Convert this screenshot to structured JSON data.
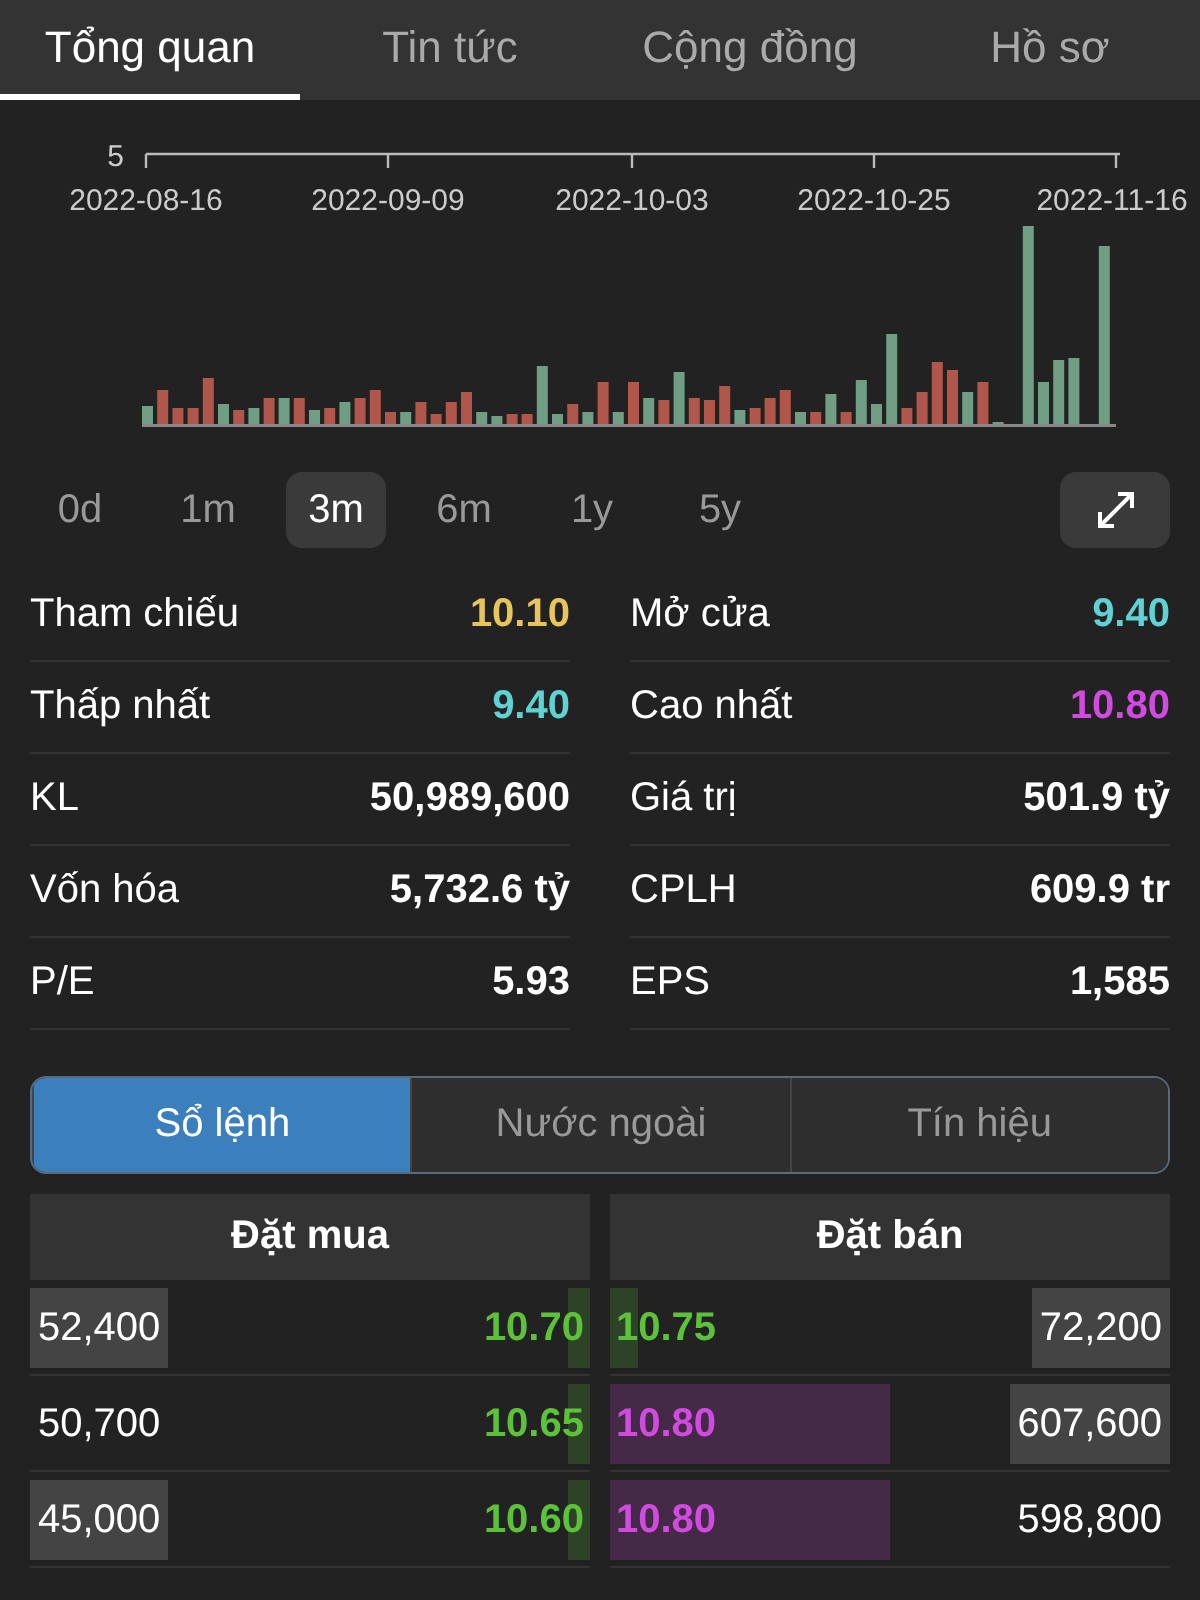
{
  "tabs": [
    {
      "label": "Tổng quan",
      "selected": true
    },
    {
      "label": "Tin tức",
      "selected": false
    },
    {
      "label": "Cộng đồng",
      "selected": false
    },
    {
      "label": "Hồ sơ",
      "selected": false
    }
  ],
  "price_axis": {
    "y_tick": "5",
    "dates": [
      "2022-08-16",
      "2022-09-09",
      "2022-10-03",
      "2022-10-25",
      "2022-11-16"
    ]
  },
  "periods": [
    {
      "label": "0d",
      "selected": false
    },
    {
      "label": "1m",
      "selected": false
    },
    {
      "label": "3m",
      "selected": true
    },
    {
      "label": "6m",
      "selected": false
    },
    {
      "label": "1y",
      "selected": false
    },
    {
      "label": "5y",
      "selected": false
    }
  ],
  "stats": [
    [
      {
        "label": "Tham chiếu",
        "value": "10.10",
        "color": "#e8c55a"
      },
      {
        "label": "Mở cửa",
        "value": "9.40",
        "color": "#5fd3d3"
      }
    ],
    [
      {
        "label": "Thấp nhất",
        "value": "9.40",
        "color": "#5fd3d3"
      },
      {
        "label": "Cao nhất",
        "value": "10.80",
        "color": "#d24be0"
      }
    ],
    [
      {
        "label": "KL",
        "value": "50,989,600",
        "color": "#ffffff"
      },
      {
        "label": "Giá trị",
        "value": "501.9 tỷ",
        "color": "#ffffff"
      }
    ],
    [
      {
        "label": "Vốn hóa",
        "value": "5,732.6 tỷ",
        "color": "#ffffff"
      },
      {
        "label": "CPLH",
        "value": "609.9 tr",
        "color": "#ffffff"
      }
    ],
    [
      {
        "label": "P/E",
        "value": "5.93",
        "color": "#ffffff"
      },
      {
        "label": "EPS",
        "value": "1,585",
        "color": "#ffffff"
      }
    ]
  ],
  "segments": [
    {
      "label": "Sổ lệnh",
      "selected": true
    },
    {
      "label": "Nước ngoài",
      "selected": false
    },
    {
      "label": "Tín hiệu",
      "selected": false
    }
  ],
  "order_book": {
    "buy_header": "Đặt mua",
    "sell_header": "Đặt bán",
    "rows": [
      {
        "buy": {
          "volume": "52,400",
          "highlighted": true,
          "price": "10.70",
          "color": "#5cc23a",
          "level": 0.04
        },
        "sell": {
          "price": "10.75",
          "color": "#5cc23a",
          "level": 0.05,
          "volume": "72,200",
          "highlighted": true
        }
      },
      {
        "buy": {
          "volume": "50,700",
          "highlighted": false,
          "price": "10.65",
          "color": "#5cc23a",
          "level": 0.04
        },
        "sell": {
          "price": "10.80",
          "color": "#d24be0",
          "level": 0.5,
          "volume": "607,600",
          "highlighted": true
        }
      },
      {
        "buy": {
          "volume": "45,000",
          "highlighted": true,
          "price": "10.60",
          "color": "#5cc23a",
          "level": 0.04
        },
        "sell": {
          "price": "10.80",
          "color": "#d24be0",
          "level": 0.5,
          "volume": "598,800",
          "highlighted": false
        }
      }
    ]
  }
}
